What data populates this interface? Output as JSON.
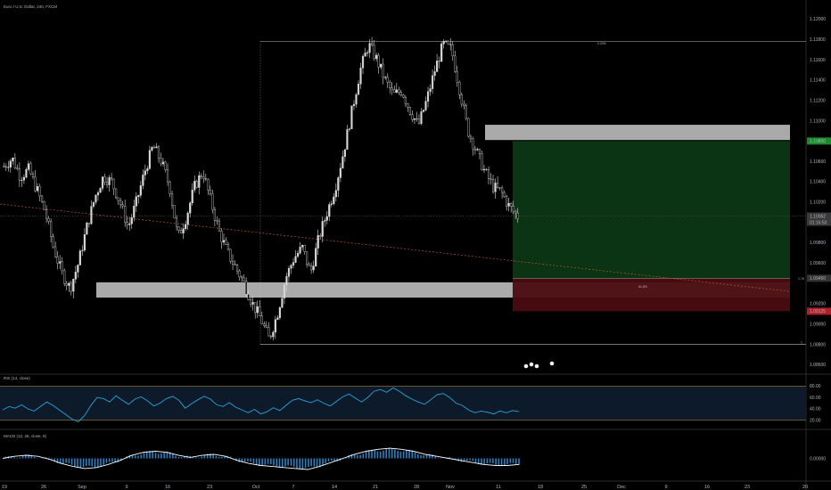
{
  "header": {
    "symbol_title": "Euro / U.S. Dollar, 240, FXCM"
  },
  "colors": {
    "background": "#000000",
    "candle": "#d8d8d8",
    "rsi_line": "#2aa3d8",
    "rsi_band": "#0c1a2a",
    "rsi_levels": "#c79a3b",
    "macd_line": "#ffffff",
    "macd_hist": "#2b7fc0",
    "zone": "#c8c8c8",
    "profit": "#0b3a16",
    "loss": "#4a0c10",
    "price_green": "#1e8a2d",
    "price_red": "#b0202b",
    "dashed_trend": "#b4562a"
  },
  "chart_data": [
    {
      "type": "candlestick",
      "title": "Euro / U.S. Dollar, 240, FXCM",
      "x_ticks": [
        "19",
        "26",
        "Sep",
        "9",
        "16",
        "23",
        "Oct",
        "7",
        "14",
        "21",
        "28",
        "Nov",
        "11",
        "18",
        "25",
        "Dec",
        "9",
        "16",
        "23",
        "20"
      ],
      "y_ticks": [
        "1.12000",
        "1.11800",
        "1.11600",
        "1.11400",
        "1.11200",
        "1.11000",
        "1.10800",
        "1.10600",
        "1.10400",
        "1.10200",
        "1.10062",
        "01:16:50",
        "1.09800",
        "1.09600",
        "1.09450",
        "1.09200",
        "1.09000",
        "1.08800",
        "1.08600"
      ],
      "ylim": [
        1.0855,
        1.121
      ],
      "price_levels": {
        "last": {
          "value": 1.10062,
          "label": "1.10062",
          "countdown": "01:16:50"
        },
        "take_profit": {
          "value": 1.108,
          "label": "1.10800"
        },
        "entry": {
          "value": 1.0945,
          "label": "1.09450"
        },
        "stop": {
          "value": 1.09125,
          "label": "1.09125"
        }
      },
      "zones": [
        {
          "name": "resistance-zone",
          "y_top": 1.1096,
          "y_bottom": 1.1081
        },
        {
          "name": "support-zone",
          "y_top": 1.0941,
          "y_bottom": 1.0926
        }
      ],
      "annotations": {
        "top_line_value": 1.1178,
        "bottom_line_value": 1.088,
        "top_line_label": "0.00%",
        "bottom_line_label": "1",
        "entry_tag": "1.76",
        "fib_text": "61.8%"
      },
      "close_path": [
        1.1055,
        1.1063,
        1.1045,
        1.1052,
        1.1032,
        1.101,
        1.0975,
        1.095,
        1.0935,
        1.096,
        1.0995,
        1.1025,
        1.1045,
        1.104,
        1.102,
        1.0995,
        1.102,
        1.105,
        1.1075,
        1.106,
        1.1035,
        1.0985,
        1.1005,
        1.1035,
        1.105,
        1.102,
        1.099,
        1.097,
        1.0955,
        1.094,
        1.092,
        1.0905,
        1.0885,
        1.091,
        1.0945,
        1.0965,
        1.0975,
        1.095,
        1.0985,
        1.101,
        1.1035,
        1.107,
        1.111,
        1.115,
        1.1175,
        1.116,
        1.114,
        1.1125,
        1.113,
        1.111,
        1.1095,
        1.112,
        1.115,
        1.1175,
        1.117,
        1.113,
        1.109,
        1.107,
        1.105,
        1.1035,
        1.103,
        1.1015,
        1.1006
      ]
    },
    {
      "type": "line",
      "title": "RSI (14, close)",
      "ylim": [
        10,
        90
      ],
      "levels": [
        80,
        20
      ],
      "y_ticks": [
        "80.00",
        "60.00",
        "40.00",
        "20.00"
      ],
      "values": [
        38,
        44,
        41,
        47,
        40,
        36,
        44,
        52,
        46,
        38,
        30,
        22,
        17,
        28,
        46,
        60,
        58,
        52,
        63,
        55,
        48,
        57,
        61,
        54,
        45,
        50,
        58,
        62,
        55,
        41,
        49,
        56,
        62,
        57,
        47,
        44,
        51,
        43,
        38,
        33,
        39,
        31,
        35,
        42,
        37,
        46,
        55,
        58,
        54,
        51,
        56,
        50,
        45,
        53,
        61,
        66,
        59,
        52,
        60,
        71,
        74,
        69,
        77,
        71,
        63,
        57,
        52,
        48,
        56,
        65,
        67,
        60,
        50,
        46,
        38,
        33,
        36,
        34,
        31,
        36,
        33,
        37,
        35
      ]
    },
    {
      "type": "line",
      "title": "MACD (12, 26, close, 9)",
      "ylim": [
        -0.0018,
        0.0018
      ],
      "y_ticks": [
        "0.00000"
      ],
      "values": [
        0.0,
        0.0002,
        0.0003,
        0.0002,
        -0.0001,
        -0.0005,
        -0.0008,
        -0.001,
        -0.0009,
        -0.0006,
        -0.0002,
        0.0003,
        0.0006,
        0.0007,
        0.0006,
        0.0003,
        0.0001,
        0.0003,
        0.0004,
        0.0002,
        -0.0002,
        -0.0005,
        -0.0007,
        -0.0008,
        -0.0009,
        -0.001,
        -0.0011,
        -0.0008,
        -0.0004,
        0.0,
        0.0004,
        0.0007,
        0.0009,
        0.001,
        0.0009,
        0.0007,
        0.0004,
        0.0002,
        0.0,
        -0.0002,
        -0.0004,
        -0.0006,
        -0.0007,
        -0.0007,
        -0.0006
      ]
    }
  ]
}
